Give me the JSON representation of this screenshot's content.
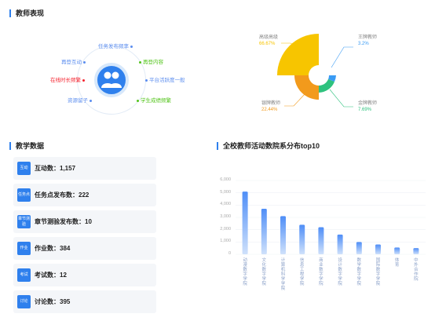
{
  "teacher_performance": {
    "title": "教师表现",
    "labels": [
      {
        "text": "任务发布频率",
        "color": "#5b8def"
      },
      {
        "text": "再登互动",
        "color": "#5b8def"
      },
      {
        "text": "再登内容",
        "color": "#52c41a"
      },
      {
        "text": "在线时长频繁",
        "color": "#f5222d"
      },
      {
        "text": "平台活跃度一般",
        "color": "#5b8def"
      },
      {
        "text": "资源留子",
        "color": "#5b8def"
      },
      {
        "text": "学生成绩频繁",
        "color": "#52c41a"
      }
    ],
    "pie": {
      "segments": [
        {
          "name": "高级高级",
          "pct": "66.67%",
          "value": 66.67,
          "color": "#f7c500"
        },
        {
          "name": "王牌教师",
          "pct": "3.2%",
          "value": 3.2,
          "color": "#3a9bf4"
        },
        {
          "name": "金牌教师",
          "pct": "7.69%",
          "value": 7.69,
          "color": "#2ec27e"
        },
        {
          "name": "银牌教师",
          "pct": "22.44%",
          "value": 22.44,
          "color": "#f29a1c"
        }
      ]
    }
  },
  "teaching_data": {
    "title": "教学数据",
    "items": [
      {
        "icon": "互动",
        "text": "互动数：1,157"
      },
      {
        "icon": "任务点",
        "text": "任务点发布数：222"
      },
      {
        "icon": "章节测验",
        "text": "章节测验发布数：10"
      },
      {
        "icon": "作业",
        "text": "作业数：384"
      },
      {
        "icon": "考试",
        "text": "考试数：12"
      },
      {
        "icon": "讨论",
        "text": "讨论数：395"
      }
    ]
  },
  "activity_chart": {
    "title": "全校教师活动数院系分布top10"
  },
  "chart_data": {
    "type": "bar",
    "title": "全校教师活动数院系分布top10",
    "categories": [
      "动漫数字学院",
      "文化数字学院",
      "计算机科学学院",
      "信息工程学院",
      "商业数字学院",
      "设计数字学院",
      "数学数字学院",
      "国际数字学院",
      "体育",
      "中外合作院"
    ],
    "values": [
      5100,
      3700,
      3100,
      2400,
      2200,
      1600,
      1000,
      800,
      550,
      500
    ],
    "yticks": [
      "6,000",
      "5,000",
      "4,000",
      "3,000",
      "2,000",
      "1,000",
      "0"
    ],
    "ylim": [
      0,
      6000
    ],
    "grid": true,
    "color_top": "#4f8ef7",
    "color_bottom": "#cfe1fb"
  }
}
